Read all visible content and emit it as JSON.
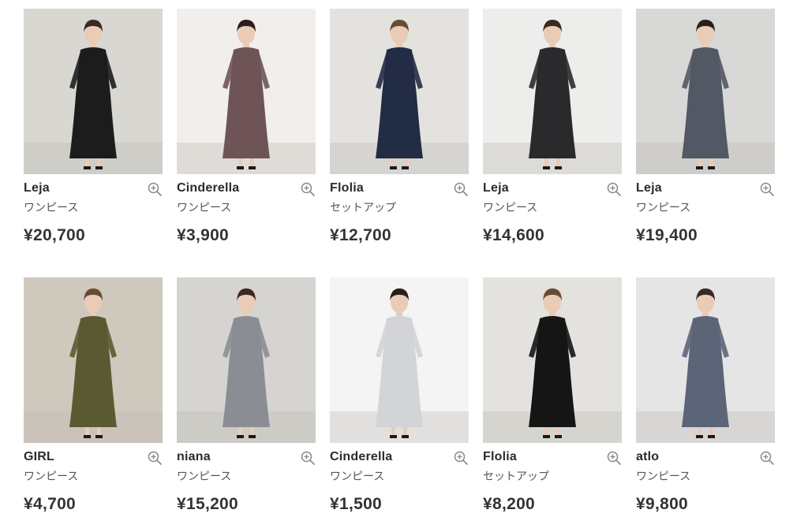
{
  "products": [
    {
      "brand": "Leja",
      "category": "ワンピース",
      "price": "¥20,700",
      "bg": "#d9d7d2",
      "dress": "#1d1c1c",
      "icon": "zoom-in-icon"
    },
    {
      "brand": "Cinderella",
      "category": "ワンピース",
      "price": "¥3,900",
      "bg": "#f1eeeb",
      "dress": "#6e5456",
      "icon": "zoom-in-icon"
    },
    {
      "brand": "Flolia",
      "category": "セットアップ",
      "price": "¥12,700",
      "bg": "#e3e2df",
      "dress": "#232c45",
      "icon": "zoom-in-icon"
    },
    {
      "brand": "Leja",
      "category": "ワンピース",
      "price": "¥14,600",
      "bg": "#ededec",
      "dress": "#2a2a2c",
      "icon": "zoom-in-icon"
    },
    {
      "brand": "Leja",
      "category": "ワンピース",
      "price": "¥19,400",
      "bg": "#d8d8d6",
      "dress": "#535865",
      "icon": "zoom-in-icon"
    },
    {
      "brand": "GIRL",
      "category": "ワンピース",
      "price": "¥4,700",
      "bg": "#cfc8bd",
      "dress": "#5a5a32",
      "icon": "zoom-in-icon"
    },
    {
      "brand": "niana",
      "category": "ワンピース",
      "price": "¥15,200",
      "bg": "#d6d4d0",
      "dress": "#8a8d93",
      "icon": "zoom-in-icon"
    },
    {
      "brand": "Cinderella",
      "category": "ワンピース",
      "price": "¥1,500",
      "bg": "#f4f4f4",
      "dress": "#d2d4d8",
      "icon": "zoom-in-icon"
    },
    {
      "brand": "Flolia",
      "category": "セットアップ",
      "price": "¥8,200",
      "bg": "#e4e2de",
      "dress": "#151515",
      "icon": "zoom-in-icon"
    },
    {
      "brand": "atlo",
      "category": "ワンピース",
      "price": "¥9,800",
      "bg": "#e5e5e6",
      "dress": "#5c6478",
      "icon": "zoom-in-icon"
    }
  ]
}
